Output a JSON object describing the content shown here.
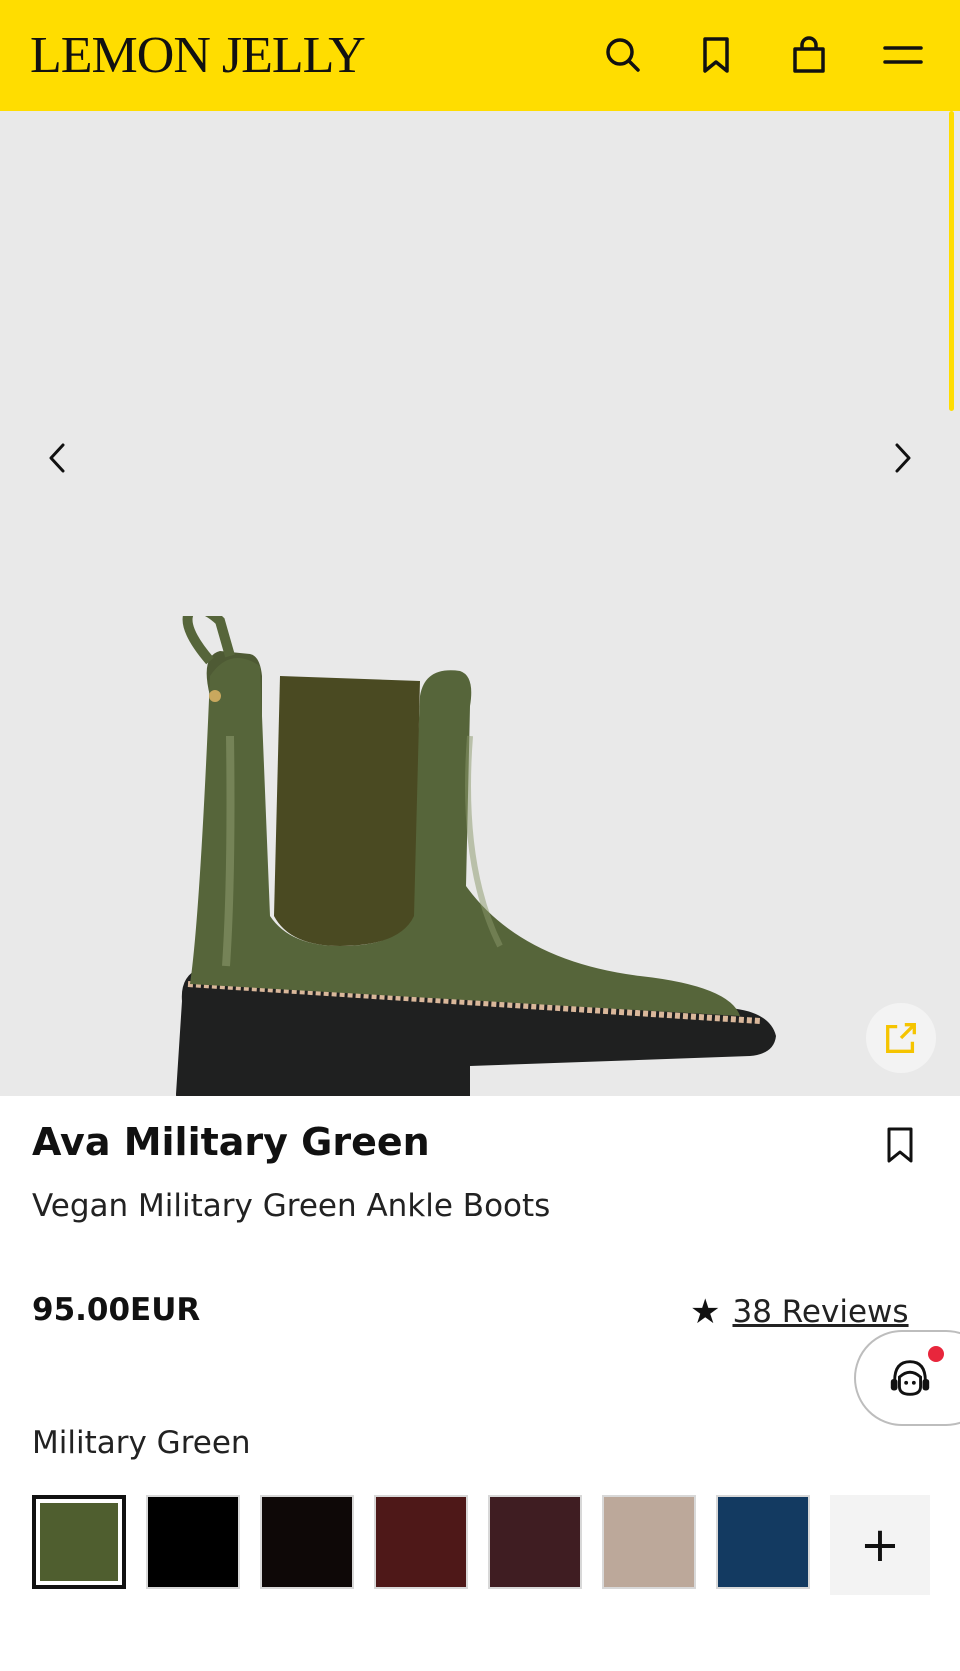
{
  "header": {
    "logo": "LEMON JELLY",
    "icons": [
      "search-icon",
      "bookmark-icon",
      "bag-icon",
      "menu-icon"
    ]
  },
  "gallery": {
    "prev_icon": "chevron-left-icon",
    "next_icon": "chevron-right-icon",
    "expand_icon": "expand-icon"
  },
  "product": {
    "name": "Ava Military Green",
    "subtitle": "Vegan Military Green Ankle Boots",
    "price": "95.00EUR",
    "reviews_label": "38 Reviews",
    "selected_color_label": "Military Green"
  },
  "colors": {
    "swatches": [
      "#4f5e2f",
      "#000000",
      "#0e0807",
      "#4e1818",
      "#3f1d22",
      "#bca89a",
      "#133a61"
    ],
    "more": "+"
  },
  "theme": {
    "brand_yellow": "#FFDD00",
    "notification_red": "#e8263c"
  }
}
